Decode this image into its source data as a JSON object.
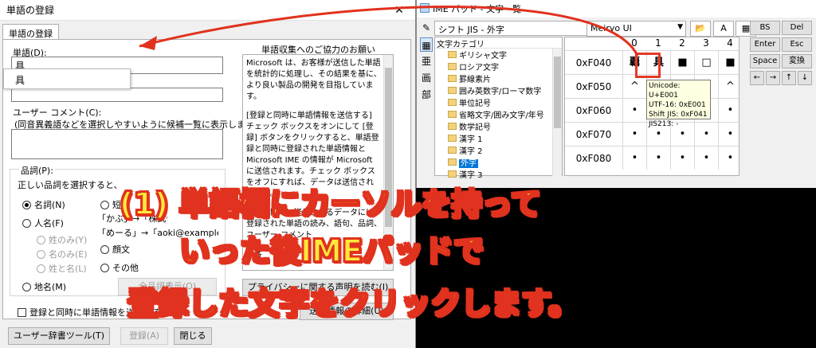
{
  "colors": {
    "annotation_red": "#e0321e",
    "caption_fill": "#ffe83a",
    "selection_blue": "#0078d7"
  },
  "register_window": {
    "title": "単語の登録",
    "tab": "単語の登録",
    "word_label": "単語(D):",
    "word_value": "具",
    "suggestion": "具",
    "comment_label": "ユーザー コメント(C):",
    "comment_hint": "(同音異義語などを選択しやすいように候補一覧に表示します)",
    "pos_label": "品詞(P):",
    "pos_hint": "正しい品詞を選択すると、より高い",
    "radios": {
      "noun": "名詞(N)",
      "person": "人名(F)",
      "surname_only": "姓のみ(Y)",
      "given_only": "名のみ(E)",
      "full_name": "姓と名(L)",
      "place": "地名(M)",
      "short": "短縮",
      "face": "顔文",
      "other": "その他"
    },
    "examples": [
      "「かぶ」→「株式会社」",
      "「めーる」→「aoki@example.com」"
    ],
    "pos_more_button": "全品詞表示(O)",
    "send_checkbox": "登録と同時に単語情報を送信する",
    "btn_dictionary_tool": "ユーザー辞書ツール(T)",
    "btn_register": "登録(A)",
    "btn_close": "閉じる",
    "info_heading": "単語収集へのご協力のお願い",
    "info_paragraphs": [
      "Microsoft は、お客様が送信した単語を統計的に処理し、その結果を基に、より良い製品の開発を目指しています。",
      "[登録と同時に単語情報を送信する] チェック ボックスをオンにして [登録] ボタンをクリックすると、単語登録と同時に登録された単語情報と Microsoft IME の情報が Microsoft に送信されます。チェック ボックスをオフにすれば、データは送信されません。",
      "登録と同時に送信されるデータには、登録された単語の読み、語句、品詞、ユーザー コメント",
      "お客"
    ],
    "privacy_button": "プライバシーに関する声明を読む(I)",
    "details_button": "送信情報の詳細(U)"
  },
  "ime_pad": {
    "title": "IME パッド - 文字一覧",
    "charset": "シフト JIS - 外字",
    "font": "Meiryo UI",
    "side_tools": [
      "✎",
      "▦",
      "亜",
      "画",
      "部"
    ],
    "category_header": "文字カテゴリ",
    "categories": [
      {
        "label": "ギリシャ文字",
        "selected": false
      },
      {
        "label": "ロシア文字",
        "selected": false
      },
      {
        "label": "罫線素片",
        "selected": false
      },
      {
        "label": "囲み英数字/ローマ数字",
        "selected": false
      },
      {
        "label": "単位記号",
        "selected": false
      },
      {
        "label": "省略文字/囲み文字/年号",
        "selected": false
      },
      {
        "label": "数学記号",
        "selected": false
      },
      {
        "label": "漢字 1",
        "selected": false
      },
      {
        "label": "漢字 2",
        "selected": false
      },
      {
        "label": "外字",
        "selected": true
      },
      {
        "label": "漢字 3",
        "selected": false
      }
    ],
    "grid_cols": [
      "0",
      "1",
      "2",
      "3",
      "4"
    ],
    "grid_rows": [
      {
        "label": "0xF040",
        "cells": [
          "覊",
          "具",
          "■",
          "□",
          "■"
        ]
      },
      {
        "label": "0xF050",
        "cells": [
          "^",
          "ˇ",
          "",
          "",
          "^"
        ]
      },
      {
        "label": "0xF060",
        "cells": [
          "•",
          "•",
          "",
          "",
          "•"
        ]
      },
      {
        "label": "0xF070",
        "cells": [
          "•",
          "•",
          "•",
          "•",
          "•"
        ]
      },
      {
        "label": "0xF080",
        "cells": [
          "•",
          "•",
          "•",
          "•",
          "•"
        ]
      }
    ],
    "tooltip": [
      "Unicode: U+E001",
      "UTF-16: 0xE001",
      "Shift JIS: 0xF041",
      "JIS213: -"
    ],
    "keys": {
      "bs": "BS",
      "del": "Del",
      "enter": "Enter",
      "esc": "Esc",
      "space": "Space",
      "convert": "変換",
      "left": "←",
      "right": "→",
      "up": "↑",
      "down": "↓"
    }
  },
  "caption": [
    "(1) 単語欄にカーソルを持って",
    "いった後IMEパッドで",
    "登録した文字をクリックします。"
  ]
}
